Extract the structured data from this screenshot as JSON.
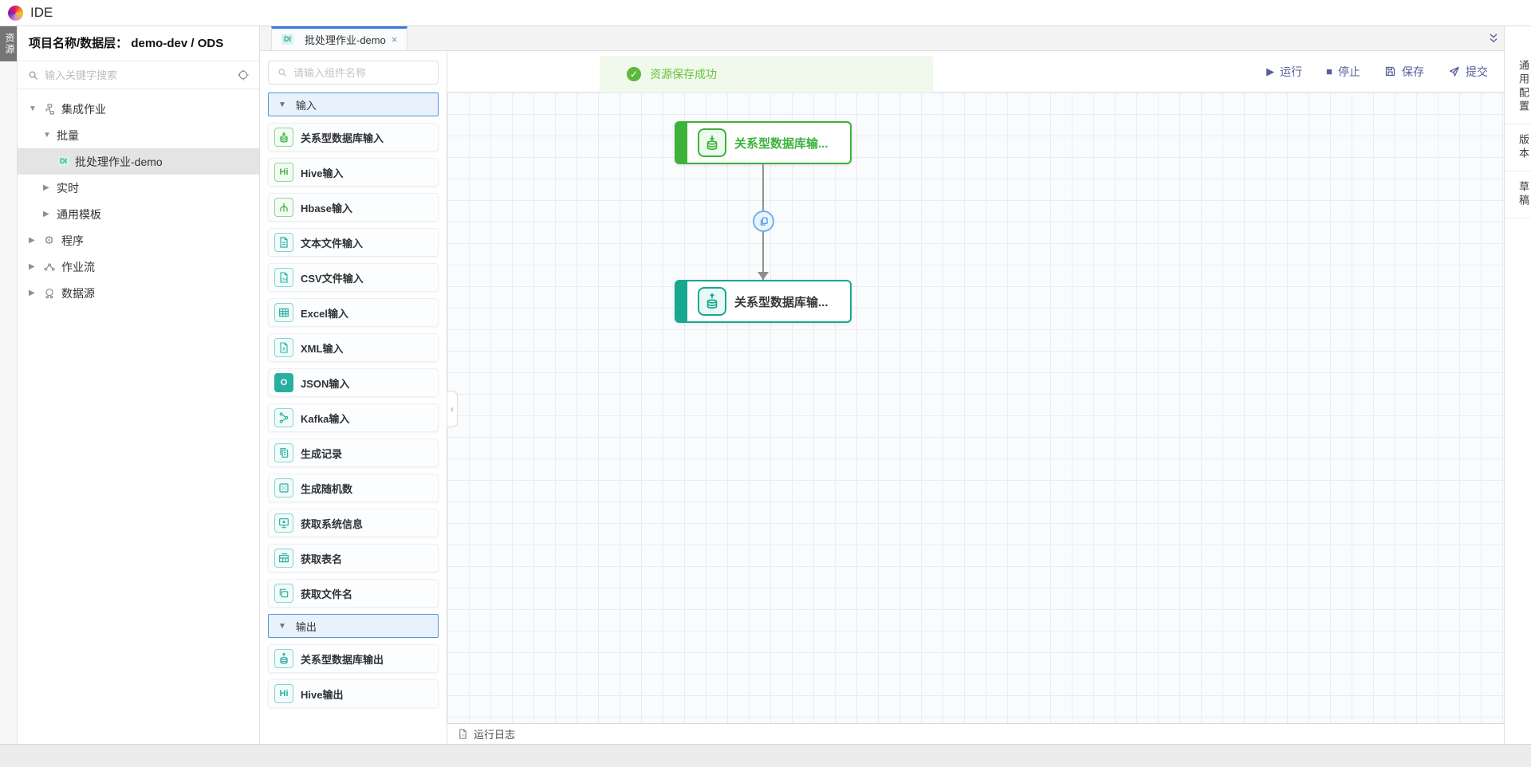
{
  "topbar": {
    "title": "IDE",
    "logo_icon": "swirl-logo-icon"
  },
  "left_rail": {
    "tab_label": "资源"
  },
  "sidebar": {
    "header": {
      "label": "项目名称/数据层：",
      "value": "demo-dev / ODS"
    },
    "search": {
      "placeholder": "输入关键字搜索",
      "icons": [
        "search-icon",
        "locate-icon"
      ]
    },
    "tree": [
      {
        "caret": "▼",
        "icon": "integration-jobs-icon",
        "label": "集成作业"
      },
      {
        "caret": "▼",
        "label": "批量"
      },
      {
        "badge": "DI",
        "label": "批处理作业-demo",
        "selected": true
      },
      {
        "caret": "▶",
        "label": "实时"
      },
      {
        "caret": "▶",
        "label": "通用模板"
      },
      {
        "caret": "▶",
        "icon": "gear-icon",
        "glyph": "⚙",
        "label": "程序"
      },
      {
        "caret": "▶",
        "icon": "workflow-icon",
        "label": "作业流"
      },
      {
        "caret": "▶",
        "icon": "datasource-icon",
        "label": "数据源"
      }
    ]
  },
  "tabs": {
    "active": {
      "badge": "DI",
      "label": "批处理作业-demo",
      "close": "×"
    }
  },
  "palette": {
    "search_placeholder": "请输入组件名称",
    "sections": [
      {
        "title": "输入",
        "caret": "▼",
        "items": [
          {
            "label": "关系型数据库输入",
            "icon": "database-input-icon",
            "color": "green"
          },
          {
            "label": "Hive输入",
            "icon": "hive-icon",
            "glyph": "Hi",
            "color": "green"
          },
          {
            "label": "Hbase输入",
            "icon": "hbase-tree-icon",
            "color": "green"
          },
          {
            "label": "文本文件输入",
            "icon": "text-file-icon",
            "color": "teal"
          },
          {
            "label": "CSV文件输入",
            "icon": "csv-file-icon",
            "glyph": "CSV",
            "color": "teal"
          },
          {
            "label": "Excel输入",
            "icon": "excel-table-icon",
            "color": "teal"
          },
          {
            "label": "XML输入",
            "icon": "xml-file-icon",
            "glyph": "X",
            "color": "teal"
          },
          {
            "label": "JSON输入",
            "icon": "json-icon",
            "glyph": "O",
            "color": "filled"
          },
          {
            "label": "Kafka输入",
            "icon": "kafka-icon",
            "color": "teal"
          },
          {
            "label": "生成记录",
            "icon": "doc-stack-icon",
            "color": "teal"
          },
          {
            "label": "生成随机数",
            "icon": "dice-icon",
            "color": "teal"
          },
          {
            "label": "获取系统信息",
            "icon": "monitor-icon",
            "color": "teal"
          },
          {
            "label": "获取表名",
            "icon": "table-icon",
            "color": "teal"
          },
          {
            "label": "获取文件名",
            "icon": "file-stack-icon",
            "color": "teal"
          }
        ]
      },
      {
        "title": "输出",
        "caret": "▼",
        "items": [
          {
            "label": "关系型数据库输出",
            "icon": "database-output-icon",
            "color": "teal"
          },
          {
            "label": "Hive输出",
            "icon": "hive-icon",
            "glyph": "Hi",
            "color": "teal"
          }
        ]
      }
    ]
  },
  "toolbar": {
    "run": "运行",
    "stop": "停止",
    "save": "保存",
    "submit": "提交",
    "run_glyph": "▶",
    "stop_glyph": "■"
  },
  "toast": {
    "message": "资源保存成功",
    "check": "✓",
    "icon": "success-check-icon"
  },
  "canvas": {
    "nodes": [
      {
        "label": "关系型数据库输...",
        "icon": "database-input-icon",
        "color": "green"
      },
      {
        "label": "关系型数据库输...",
        "icon": "database-output-icon",
        "color": "teal"
      }
    ],
    "edge": {
      "badge_icon": "copy-icon"
    },
    "collapse_glyph": "‹"
  },
  "right_rail": {
    "tabs": [
      "通用配置",
      "版本",
      "草稿"
    ]
  },
  "bottom_bar": {
    "log_label": "运行日志",
    "icon": "log-file-icon"
  },
  "colors": {
    "accent_blue": "#3a7bd8",
    "green": "#3cb13c",
    "teal": "#17a88f",
    "toolbar_purple": "#585d9c",
    "success_green": "#67c23a",
    "toast_bg": "#f0f9eb"
  }
}
